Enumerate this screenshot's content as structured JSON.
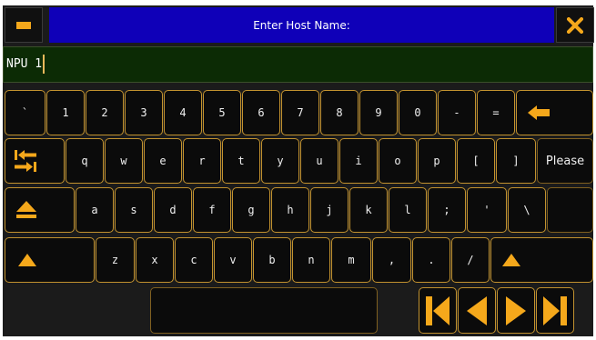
{
  "header": {
    "title": "Enter Host Name:",
    "minimize_icon": "minus-icon",
    "close_icon": "close-x-icon"
  },
  "input": {
    "value": "NPU 1"
  },
  "keyboard": {
    "row1": [
      "`",
      "1",
      "2",
      "3",
      "4",
      "5",
      "6",
      "7",
      "8",
      "9",
      "0",
      "-",
      "="
    ],
    "row2": [
      "q",
      "w",
      "e",
      "r",
      "t",
      "y",
      "u",
      "i",
      "o",
      "p",
      "[",
      "]"
    ],
    "row3": [
      "a",
      "s",
      "d",
      "f",
      "g",
      "h",
      "j",
      "k",
      "l",
      ";",
      "'",
      "\\"
    ],
    "row4": [
      "z",
      "x",
      "c",
      "v",
      "b",
      "n",
      "m",
      ",",
      ".",
      "/"
    ],
    "please_label": "Please",
    "icons": {
      "backspace": "arrow-left-icon",
      "tab": "tab-icon",
      "capslock": "eject-icon",
      "shift": "triangle-up-icon",
      "first": "skip-to-start-icon",
      "prev": "triangle-left-icon",
      "next": "triangle-right-icon",
      "last": "skip-to-end-icon"
    }
  },
  "colors": {
    "accent": "#f5a81b",
    "title_bar": "#0f00b8",
    "input_bg": "#0c2b05",
    "key_border": "#c2922f"
  }
}
